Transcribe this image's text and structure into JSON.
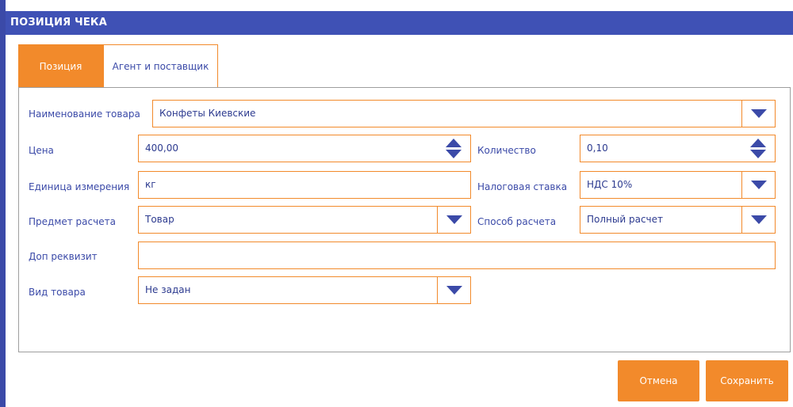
{
  "window": {
    "title": "ПОЗИЦИЯ ЧЕКА"
  },
  "tabs": [
    {
      "label": "Позиция",
      "active": true
    },
    {
      "label": "Агент и поставщик",
      "active": false
    }
  ],
  "form": {
    "product_name": {
      "label": "Наименование товара",
      "value": "Конфеты Киевские"
    },
    "price": {
      "label": "Цена",
      "value": "400,00"
    },
    "quantity": {
      "label": "Количество",
      "value": "0,10"
    },
    "unit": {
      "label": "Единица измерения",
      "value": "кг"
    },
    "tax_rate": {
      "label": "Налоговая ставка",
      "value": "НДС 10%"
    },
    "payment_subject": {
      "label": "Предмет расчета",
      "value": "Товар"
    },
    "payment_method": {
      "label": "Способ расчета",
      "value": "Полный расчет"
    },
    "extra_requisite": {
      "label": "Доп реквизит",
      "value": ""
    },
    "product_type": {
      "label": "Вид товара",
      "value": "Не задан"
    }
  },
  "buttons": {
    "cancel": "Отмена",
    "save": "Сохранить"
  },
  "colors": {
    "titlebar": "#3f51b5",
    "accent": "#f28a2b",
    "text": "#3b4aa8"
  }
}
